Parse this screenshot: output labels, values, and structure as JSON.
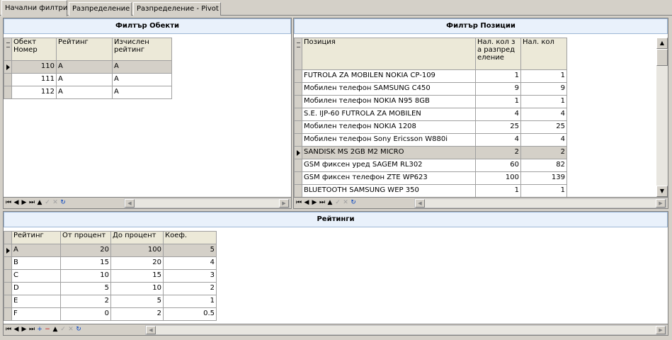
{
  "tabs": [
    {
      "label": "Начални филтри",
      "active": true
    },
    {
      "label": "Разпределение",
      "active": false
    },
    {
      "label": "Разпределение - Pivot",
      "active": false
    }
  ],
  "objects_panel": {
    "title": "Филтър Обекти",
    "columns": [
      "Обект Номер",
      "Рейтинг",
      "Изчислен рейтинг"
    ],
    "rows": [
      {
        "num": "110",
        "rating": "A",
        "calc": "A",
        "selected": true
      },
      {
        "num": "111",
        "rating": "A",
        "calc": "A",
        "selected": false
      },
      {
        "num": "112",
        "rating": "A",
        "calc": "A",
        "selected": false
      }
    ]
  },
  "positions_panel": {
    "title": "Филтър Позиции",
    "columns": [
      "Позиция",
      "Нал. кол за разпределение",
      "Нал. кол"
    ],
    "rows": [
      {
        "name": "FUTROLA ZA MOBILEN NOKIA CP-109",
        "alloc": "1",
        "qty": "1",
        "selected": false
      },
      {
        "name": "Мобилен телефон SAMSUNG C450",
        "alloc": "9",
        "qty": "9",
        "selected": false
      },
      {
        "name": "Мобилен телефон NOKIA N95 8GB",
        "alloc": "1",
        "qty": "1",
        "selected": false
      },
      {
        "name": "S.E. IJP-60 FUTROLA ZA MOBILEN",
        "alloc": "4",
        "qty": "4",
        "selected": false
      },
      {
        "name": "Мобилен телефон NOKIA 1208",
        "alloc": "25",
        "qty": "25",
        "selected": false
      },
      {
        "name": "Мобилен телефон Sony Ericsson W880i",
        "alloc": "4",
        "qty": "4",
        "selected": false
      },
      {
        "name": "SANDISK MS 2GB M2 MICRO",
        "alloc": "2",
        "qty": "2",
        "selected": true
      },
      {
        "name": "GSM фиксен уред SAGEM RL302",
        "alloc": "60",
        "qty": "82",
        "selected": false
      },
      {
        "name": "GSM фиксен телефон ZTE WP623",
        "alloc": "100",
        "qty": "139",
        "selected": false
      },
      {
        "name": "BLUETOOTH SAMSUNG WEP 350",
        "alloc": "1",
        "qty": "1",
        "selected": false
      }
    ]
  },
  "ratings_panel": {
    "title": "Рейтинги",
    "columns": [
      "Рейтинг",
      "От процент",
      "До процент",
      "Коеф."
    ],
    "rows": [
      {
        "rating": "A",
        "from": "20",
        "to": "100",
        "coef": "5",
        "selected": true
      },
      {
        "rating": "B",
        "from": "15",
        "to": "20",
        "coef": "4",
        "selected": false
      },
      {
        "rating": "C",
        "from": "10",
        "to": "15",
        "coef": "3",
        "selected": false
      },
      {
        "rating": "D",
        "from": "5",
        "to": "10",
        "coef": "2",
        "selected": false
      },
      {
        "rating": "E",
        "from": "2",
        "to": "5",
        "coef": "1",
        "selected": false
      },
      {
        "rating": "F",
        "from": "0",
        "to": "2",
        "coef": "0.5",
        "selected": false
      }
    ]
  },
  "navigator": {
    "first": "⏮",
    "prior": "◀",
    "next": "▶",
    "last": "⏭",
    "insert": "+",
    "delete": "−",
    "edit": "▲",
    "post": "✓",
    "cancel": "✕",
    "refresh": "↻"
  },
  "scroll": {
    "left": "◀",
    "right": "▶",
    "up": "▲",
    "down": "▼"
  }
}
